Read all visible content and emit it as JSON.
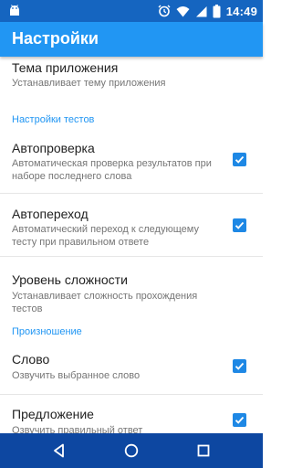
{
  "status_bar": {
    "time": "14:49",
    "icons": [
      "android-icon",
      "alarm-icon",
      "wifi-icon",
      "signal-icon",
      "battery-icon"
    ]
  },
  "app_bar": {
    "title": "Настройки"
  },
  "preferences": {
    "theme": {
      "title": "Тема приложения",
      "summary": "Устанавливает тему приложения"
    },
    "tests_category": "Настройки тестов",
    "autocheck": {
      "title": "Автопроверка",
      "summary": "Автоматическая проверка результатов при наборе последнего слова",
      "checked": true
    },
    "autonext": {
      "title": "Автопереход",
      "summary": "Автоматический переход к следующему тесту при правильном ответе",
      "checked": true
    },
    "difficulty": {
      "title": "Уровень сложности",
      "summary": "Устанавливает сложность прохождения тестов"
    },
    "pronunciation_category": "Произношение",
    "word": {
      "title": "Слово",
      "summary": "Озвучить выбранное слово",
      "checked": true
    },
    "sentence": {
      "title": "Предложение",
      "summary": "Озвучить правильный ответ",
      "checked": true
    }
  },
  "nav_bar": {
    "icons": [
      "back-icon",
      "home-icon",
      "recents-icon"
    ]
  },
  "colors": {
    "status_bar": "#1565c0",
    "app_bar": "#2196f3",
    "accent": "#2196f3",
    "checkbox": "#1e88e5",
    "nav_bar": "#0d47a1"
  }
}
